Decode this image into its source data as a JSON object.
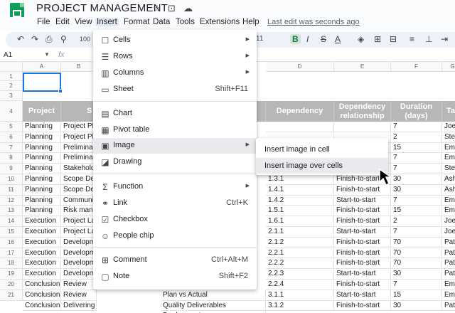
{
  "app": {
    "title": "PROJECT MANAGEMENT",
    "last_edit": "Last edit was seconds ago"
  },
  "menu": [
    "File",
    "Edit",
    "View",
    "Insert",
    "Format",
    "Data",
    "Tools",
    "Extensions",
    "Help"
  ],
  "toolbar": {
    "zoom": "100",
    "font_size": "11",
    "bold": "B"
  },
  "formula_bar": {
    "cell_ref": "A1",
    "fx": "fx"
  },
  "columns": [
    "A",
    "B",
    "C",
    "D",
    "E",
    "F",
    "G"
  ],
  "row_numbers": [
    "1",
    "2",
    "3",
    "4",
    "5",
    "6",
    "7",
    "8",
    "9",
    "10",
    "11",
    "12",
    "13",
    "14",
    "15",
    "16",
    "17",
    "18",
    "19",
    "20",
    "21"
  ],
  "header_row": [
    "Project",
    "S",
    "",
    "Dependency",
    "Dependency relationship",
    "Duration (days)",
    "Ta"
  ],
  "rows": [
    [
      "Planning",
      "Project Pla",
      "",
      "",
      "7",
      "Joe"
    ],
    [
      "Planning",
      "Project Pla",
      "",
      "",
      "2",
      "Step"
    ],
    [
      "Planning",
      "Prelimina",
      "",
      "",
      "15",
      "Ema"
    ],
    [
      "Planning",
      "Prelimina",
      "",
      "",
      "7",
      "Ema"
    ],
    [
      "Planning",
      "Stakeholde",
      "",
      "",
      "7",
      "Step"
    ],
    [
      "Planning",
      "Scope Def",
      "1.3.1",
      "Finish-to-start",
      "30",
      "Ash"
    ],
    [
      "Planning",
      "Scope Def",
      "1.4.1",
      "Finish-to-start",
      "30",
      "Ash"
    ],
    [
      "Planning",
      "Communi",
      "1.4.2",
      "Start-to-start",
      "7",
      "Ema"
    ],
    [
      "Planning",
      "Risk mana",
      "1.5.1",
      "Finish-to-start",
      "15",
      "Ema"
    ],
    [
      "Execution",
      "Project La",
      "1.6.1",
      "Finish-to-start",
      "2",
      "Joe"
    ],
    [
      "Execution",
      "Project La",
      "2.1.1",
      "Start-to-start",
      "7",
      "Joe"
    ],
    [
      "Execution",
      "Developm",
      "2.1.2",
      "Finish-to-start",
      "70",
      "Pat"
    ],
    [
      "Execution",
      "Developm",
      "2.2.1",
      "Finish-to-start",
      "70",
      "Pat"
    ],
    [
      "Execution",
      "Developm",
      "2.2.2",
      "Finish-to-start",
      "70",
      "Pat"
    ],
    [
      "Execution",
      "Developm",
      "2.2.3",
      "Start-to-start",
      "30",
      "Pat"
    ],
    [
      "Conclusion",
      "Review",
      "2.2.4",
      "Finish-to-start",
      "7",
      "Ema"
    ],
    [
      "Conclusion",
      "Review",
      "3.1.1",
      "Start-to-start",
      "15",
      "Ema"
    ],
    [
      "Conclusion",
      "Delivering",
      "3.1.2",
      "Finish-to-start",
      "30",
      "Pat"
    ]
  ],
  "visible_c_cells": [
    {
      "row": 16,
      "text": "Plan vs Actual"
    },
    {
      "row": 17,
      "text": "Quality Deliverables"
    },
    {
      "row": 18,
      "text": "Deployment"
    }
  ],
  "insert_menu": [
    {
      "label": "Cells",
      "icon": "☐",
      "arrow": true
    },
    {
      "label": "Rows",
      "icon": "☰",
      "arrow": true
    },
    {
      "label": "Columns",
      "icon": "▥",
      "arrow": true
    },
    {
      "label": "Sheet",
      "icon": "▭",
      "shortcut": "Shift+F11"
    },
    {
      "label": "Chart",
      "icon": "▤"
    },
    {
      "label": "Pivot table",
      "icon": "▦"
    },
    {
      "label": "Image",
      "icon": "▣",
      "arrow": true
    },
    {
      "label": "Drawing",
      "icon": "◪"
    },
    {
      "label": "Function",
      "icon": "Σ",
      "arrow": true
    },
    {
      "label": "Link",
      "icon": "⚭",
      "shortcut": "Ctrl+K"
    },
    {
      "label": "Checkbox",
      "icon": "☑"
    },
    {
      "label": "People chip",
      "icon": "☺"
    },
    {
      "label": "Comment",
      "icon": "⊞",
      "shortcut": "Ctrl+Alt+M"
    },
    {
      "label": "Note",
      "icon": "▢",
      "shortcut": "Shift+F2"
    }
  ],
  "image_submenu": [
    "Insert image in cell",
    "Insert image over cells"
  ]
}
